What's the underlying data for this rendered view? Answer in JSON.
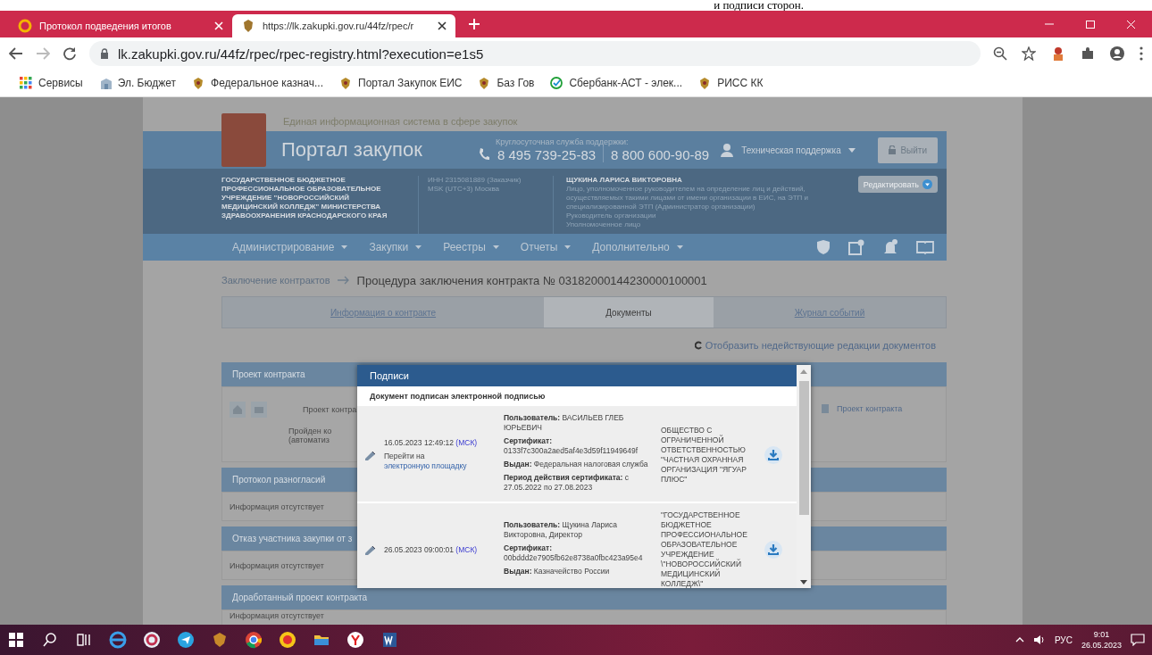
{
  "document_caption": "и подписи сторон.",
  "browser": {
    "tabs": [
      {
        "title": "Протокол подведения итогов",
        "selected": false
      },
      {
        "title": "https://lk.zakupki.gov.ru/44fz/rpec/r",
        "selected": true
      }
    ],
    "address": "lk.zakupki.gov.ru/44fz/rpec/rpec-registry.html?execution=e1s5",
    "bookmarks": [
      {
        "label": "Сервисы",
        "kind": "apps"
      },
      {
        "label": "Эл. Бюджет",
        "kind": "building"
      },
      {
        "label": "Федеральное казнач...",
        "kind": "emblem"
      },
      {
        "label": "Портал Закупок ЕИС",
        "kind": "emblem"
      },
      {
        "label": "Баз Гов",
        "kind": "emblem"
      },
      {
        "label": "Сбербанк-АСТ - элек...",
        "kind": "check"
      },
      {
        "label": "РИСС КК",
        "kind": "emblem"
      }
    ]
  },
  "portal": {
    "subtitle": "Единая информационная система в сфере закупок",
    "title": "Портал закупок",
    "support_label": "Круглосуточная служба поддержки:",
    "phones": [
      "8 495 739-25-83",
      "8 800 600-90-89"
    ],
    "support_menu": "Техническая поддержка",
    "logout": "Выйти",
    "organization_lines": [
      "ГОСУДАРСТВЕННОЕ БЮДЖЕТНОЕ",
      "ПРОФЕССИОНАЛЬНОЕ ОБРАЗОВАТЕЛЬНОЕ",
      "УЧРЕЖДЕНИЕ \"НОВОРОССИЙСКИЙ",
      "МЕДИЦИНСКИЙ КОЛЛЕДЖ\" МИНИСТЕРСТВА",
      "ЗДРАВООХРАНЕНИЯ КРАСНОДАРСКОГО КРАЯ"
    ],
    "inn": "ИНН 2315081889 (Заказчик)",
    "timezone": "MSK (UTC+3) Москва",
    "user_name": "ЩУКИНА ЛАРИСА ВИКТОРОВНА",
    "user_role_lines": [
      "Лицо, уполномоченное руководителем на определение лиц и действий,",
      "осуществляемых такими лицами от имени организации в ЕИС, на ЭТП и",
      "специализированной ЭТП (Администратор организации)",
      "Руководитель организации",
      "Уполномоченное лицо"
    ],
    "edit": "Редактировать",
    "nav": [
      "Администрирование",
      "Закупки",
      "Реестры",
      "Отчеты",
      "Дополнительно"
    ]
  },
  "breadcrumb": {
    "link": "Заключение контрактов",
    "current": "Процедура заключения контракта № 03182000144230000100001"
  },
  "tabs": [
    {
      "label": "Информация о контракте",
      "selected": false
    },
    {
      "label": "Документы",
      "selected": true
    },
    {
      "label": "Журнал событий",
      "selected": false
    }
  ],
  "toggle_link": "Отобразить недействующие редакции документов",
  "sections": [
    {
      "title": "Проект контракта",
      "kind": "documents",
      "texts": [
        "Проект контра",
        "Пройден ко",
        "(автоматиз"
      ],
      "link": "Проект контракта"
    },
    {
      "title": "Протокол разногласий",
      "kind": "empty",
      "body": "Информация отсутствует"
    },
    {
      "title": "Отказ участника закупки от з",
      "kind": "empty",
      "body": "Информация отсутствует"
    },
    {
      "title": "Доработанный проект контракта",
      "kind": "empty",
      "body": "Информация отсутствует"
    }
  ],
  "modal": {
    "title": "Подписи",
    "subtitle": "Документ подписан электронной подписью",
    "signatures": [
      {
        "date": "16.05.2023 12:49:12",
        "tz": "(МСК)",
        "link_prefix": "Перейти на",
        "link": "электронную площадку",
        "fields": [
          {
            "label": "Пользователь:",
            "value": "ВАСИЛЬЕВ ГЛЕБ ЮРЬЕВИЧ"
          },
          {
            "label": "Сертификат:",
            "value": "0133f7c300a2aed5af4e3d59f11949649f"
          },
          {
            "label": "Выдан:",
            "value": "Федеральная налоговая служба"
          },
          {
            "label": "Период действия сертификата:",
            "value": "с 27.05.2022 по 27.08.2023"
          }
        ],
        "organization": "ОБЩЕСТВО С ОГРАНИЧЕННОЙ ОТВЕТСТВЕННОСТЬЮ \"ЧАСТНАЯ ОХРАННАЯ ОРГАНИЗАЦИЯ \"ЯГУАР ПЛЮС\""
      },
      {
        "date": "26.05.2023 09:00:01",
        "tz": "(МСК)",
        "fields": [
          {
            "label": "Пользователь:",
            "value": "Щукина Лариса Викторовна, Директор"
          },
          {
            "label": "Сертификат:",
            "value": "00bddd2e7905fb62e8738a0fbc423a95e4"
          },
          {
            "label": "Выдан:",
            "value": "Казначейство России"
          }
        ],
        "organization": "\"ГОСУДАРСТВЕННОЕ БЮДЖЕТНОЕ ПРОФЕССИОНАЛЬНОЕ ОБРАЗОВАТЕЛЬНОЕ УЧРЕЖДЕНИЕ \\\"НОВОРОССИЙСКИЙ МЕДИЦИНСКИЙ КОЛЛЕДЖ\\\""
      }
    ]
  },
  "tray": {
    "language": "РУС",
    "time": "9:01",
    "date": "26.05.2023"
  }
}
